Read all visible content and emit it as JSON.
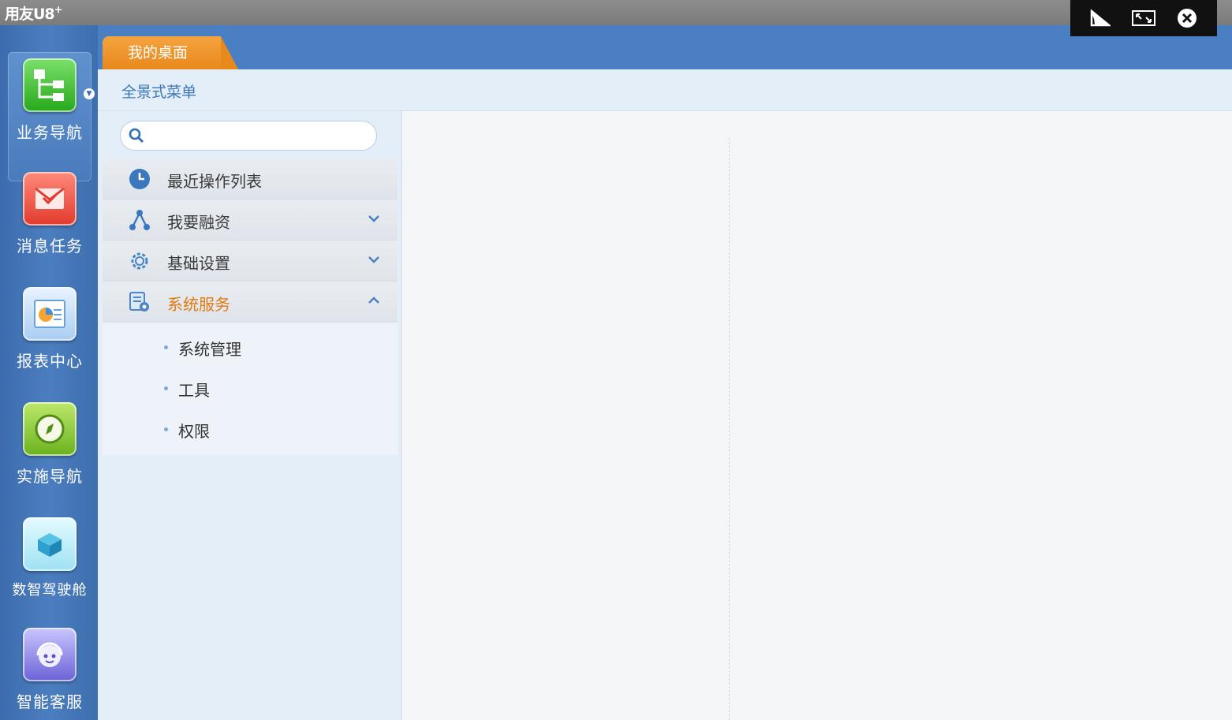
{
  "app": {
    "title": "用友U8",
    "title_sup": "+"
  },
  "window_controls": [
    {
      "name": "send-icon"
    },
    {
      "name": "restore-icon"
    },
    {
      "name": "close-icon"
    }
  ],
  "rail": {
    "items": [
      {
        "label": "业务导航",
        "icon": "business-nav-icon",
        "active": true
      },
      {
        "label": "消息任务",
        "icon": "message-task-icon"
      },
      {
        "label": "报表中心",
        "icon": "report-center-icon"
      },
      {
        "label": "实施导航",
        "icon": "compass-icon"
      },
      {
        "label": "数智驾驶舱",
        "icon": "cockpit-icon"
      },
      {
        "label": "智能客服",
        "icon": "customer-service-icon"
      }
    ]
  },
  "tabs": {
    "active_label": "我的桌面"
  },
  "subheader": {
    "title": "全景式菜单"
  },
  "search": {
    "placeholder": "",
    "value": ""
  },
  "menu": {
    "items": [
      {
        "label": "最近操作列表",
        "icon": "clock-icon",
        "chevron": ""
      },
      {
        "label": "我要融资",
        "icon": "network-icon",
        "chevron": "down"
      },
      {
        "label": "基础设置",
        "icon": "gear-icon",
        "chevron": "down"
      },
      {
        "label": "系统服务",
        "icon": "system-service-icon",
        "chevron": "up",
        "expanded": true
      }
    ],
    "subitems": [
      "系统管理",
      "工具",
      "权限"
    ]
  }
}
